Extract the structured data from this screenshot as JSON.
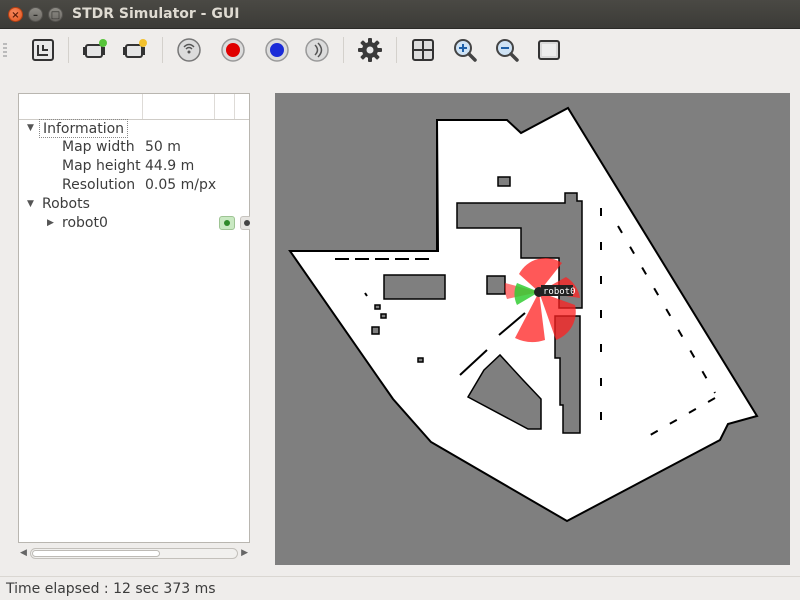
{
  "window": {
    "title": "STDR Simulator - GUI"
  },
  "toolbar": {
    "buttons": [
      {
        "icon": "load-map-icon"
      },
      {
        "icon": "add-robot-icon"
      },
      {
        "icon": "load-robot-icon"
      },
      {
        "icon": "rfid-tag-icon"
      },
      {
        "icon": "co2-source-icon",
        "color": "#e00000"
      },
      {
        "icon": "thermal-source-icon",
        "color": "#1a2bd8"
      },
      {
        "icon": "sound-source-icon"
      },
      {
        "icon": "properties-gear-icon"
      },
      {
        "icon": "grid-icon"
      },
      {
        "icon": "zoom-in-icon"
      },
      {
        "icon": "zoom-out-icon"
      },
      {
        "icon": "adjust-view-icon"
      }
    ]
  },
  "tree": {
    "information": {
      "label": "Information",
      "rows": [
        {
          "key": "Map width",
          "value": "50 m"
        },
        {
          "key": "Map height",
          "value": "44.9 m"
        },
        {
          "key": "Resolution",
          "value": "0.05 m/px"
        }
      ]
    },
    "robots": {
      "label": "Robots",
      "items": [
        {
          "name": "robot0"
        }
      ]
    }
  },
  "map": {
    "robot_label": "robot0",
    "colors": {
      "background": "#7f7f7f",
      "free": "#ffffff",
      "wall": "#000000",
      "sonar": "#ff0000",
      "laser": "#00cc00"
    }
  },
  "status": {
    "text": "Time elapsed : 12 sec 373 ms"
  }
}
